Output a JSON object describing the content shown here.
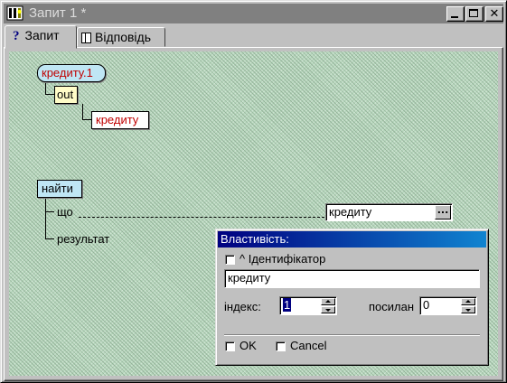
{
  "window": {
    "title": "Запит 1 *",
    "minimize_glyph": "",
    "maximize_glyph": "",
    "close_glyph": "✕"
  },
  "tabs": [
    {
      "label": "Запит",
      "icon": "question-icon",
      "active": true
    },
    {
      "label": "Відповідь",
      "icon": "document-icon",
      "active": false
    }
  ],
  "diagram": {
    "node_credit_1": "кредиту.1",
    "node_out": "out",
    "node_credit": "кредиту",
    "node_find": "найти",
    "label_what": "що",
    "label_result": "результат",
    "value_field": "кредиту",
    "ellipsis": "..."
  },
  "property_dialog": {
    "title": "Властивість:",
    "identifier_label": "^ Ідентифікатор",
    "identifier_checked": false,
    "identifier_value": "кредиту",
    "index_label": "індекс:",
    "index_value": "1",
    "reference_label": "посилан",
    "reference_value": "0",
    "ok_label": "OK",
    "cancel_label": "Cancel"
  },
  "colors": {
    "titlebar_inactive": "#808080",
    "dialog_title": "#000080",
    "canvas": "#b7d7bd",
    "node_blue": "#bfe6f4",
    "node_yellow": "#fffcc8",
    "node_text_red": "#c00000"
  }
}
